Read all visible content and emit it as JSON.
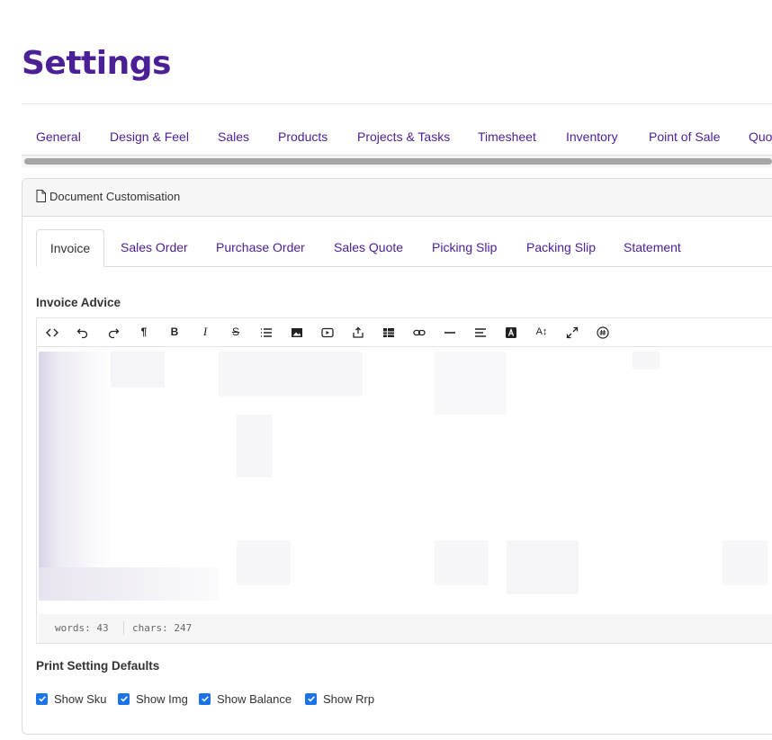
{
  "page": {
    "title": "Settings"
  },
  "top_tabs": [
    "General",
    "Design & Feel",
    "Sales",
    "Products",
    "Projects & Tasks",
    "Timesheet",
    "Inventory",
    "Point of Sale",
    "Quo"
  ],
  "card": {
    "title": "Document Customisation",
    "icon": "document-icon"
  },
  "doc_tabs": {
    "active": "Invoice",
    "items": [
      "Invoice",
      "Sales Order",
      "Purchase Order",
      "Sales Quote",
      "Picking Slip",
      "Packing Slip",
      "Statement"
    ]
  },
  "invoice_advice": {
    "label": "Invoice Advice",
    "toolbar": [
      "code-view-icon",
      "undo-icon",
      "redo-icon",
      "paragraph-icon",
      "bold-icon",
      "italic-icon",
      "strikethrough-icon",
      "list-icon",
      "image-icon",
      "video-icon",
      "embed-icon",
      "table-icon",
      "link-icon",
      "horizontal-rule-icon",
      "align-icon",
      "text-color-icon",
      "font-size-icon",
      "fullscreen-icon",
      "special-char-icon"
    ],
    "status": {
      "words": "words: 43",
      "chars": "chars: 247"
    }
  },
  "print_defaults": {
    "label": "Print Setting Defaults",
    "options": [
      {
        "label": "Show Sku",
        "checked": true
      },
      {
        "label": "Show Img",
        "checked": true
      },
      {
        "label": "Show Balance",
        "checked": true
      },
      {
        "label": "Show Rrp",
        "checked": true
      }
    ]
  },
  "colors": {
    "brand": "#4b1f96",
    "checkbox": "#1a73e8",
    "border": "#dcdcdc"
  }
}
